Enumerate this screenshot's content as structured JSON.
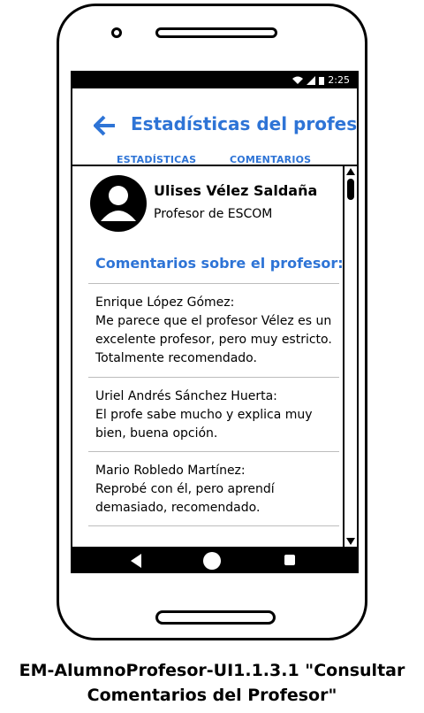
{
  "status_bar": {
    "time": "2:25"
  },
  "header": {
    "title": "Estadísticas del profesor",
    "tabs": [
      {
        "label": "ESTADÍSTICAS",
        "selected": false
      },
      {
        "label": "COMENTARIOS",
        "selected": true
      }
    ]
  },
  "profile": {
    "name": "Ulises Vélez Saldaña",
    "role": "Profesor de ESCOM"
  },
  "comments_section": {
    "title": "Comentarios sobre el profesor:",
    "comments": [
      {
        "author": "Enrique López Gómez:",
        "text": "Me parece que el profesor Vélez es un excelente profesor, pero muy estricto. Totalmente recomendado."
      },
      {
        "author": "Uriel Andrés Sánchez Huerta:",
        "text": "El profe sabe mucho y explica muy bien, buena opción."
      },
      {
        "author": "Mario Robledo Martínez:",
        "text": "Reprobé con él, pero aprendí demasiado, recomendado."
      }
    ]
  },
  "caption": {
    "line1": "EM-AlumnoProfesor-UI1.1.3.1 \"Consultar",
    "line2": "Comentarios del Profesor\""
  },
  "colors": {
    "accent": "#2e74d6"
  }
}
